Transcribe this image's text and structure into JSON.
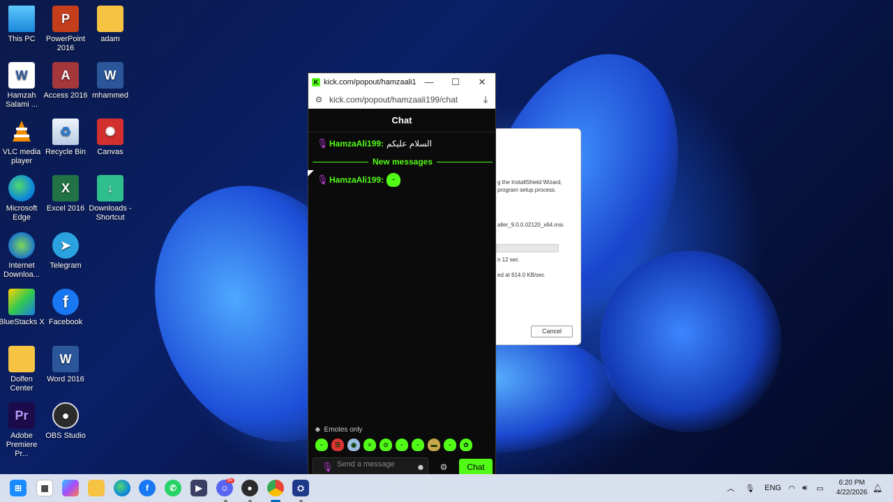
{
  "desktop": {
    "icons": [
      {
        "label": "This PC",
        "icon": "monitor-icon"
      },
      {
        "label": "PowerPoint 2016",
        "icon": "powerpoint-icon"
      },
      {
        "label": "adam",
        "icon": "folder-icon"
      },
      {
        "label": "Hamzah Salami ...",
        "icon": "word-doc-icon"
      },
      {
        "label": "Access 2016",
        "icon": "access-icon"
      },
      {
        "label": "mhammed",
        "icon": "word-doc-icon"
      },
      {
        "label": "VLC media player",
        "icon": "vlc-icon"
      },
      {
        "label": "Recycle Bin",
        "icon": "recycle-bin-icon"
      },
      {
        "label": "Canvas",
        "icon": "canvas-icon"
      },
      {
        "label": "Microsoft Edge",
        "icon": "edge-icon"
      },
      {
        "label": "Excel 2016",
        "icon": "excel-icon"
      },
      {
        "label": "Downloads - Shortcut",
        "icon": "downloads-folder-icon"
      },
      {
        "label": "Internet Downloa...",
        "icon": "idm-icon"
      },
      {
        "label": "Telegram",
        "icon": "telegram-icon"
      },
      {
        "label": "BlueStacks X",
        "icon": "bluestacks-icon"
      },
      {
        "label": "Facebook",
        "icon": "facebook-icon"
      },
      {
        "label": "Dolfen Center",
        "icon": "folder-user-icon"
      },
      {
        "label": "Word 2016",
        "icon": "word-icon"
      },
      {
        "label": "Adobe Premiere Pr...",
        "icon": "premiere-icon"
      },
      {
        "label": "OBS Studio",
        "icon": "obs-icon"
      }
    ]
  },
  "installer": {
    "line1": "g the InstallShield Wizard,",
    "line2": "program setup process.",
    "file": "aller_9.0.0.02120_x64.msi.",
    "time": "n 12 sec",
    "speed": "ed at 614.0 KB/sec",
    "cancel": "Cancel"
  },
  "popup": {
    "tab_title": "kick.com/popout/hamzaali1...",
    "url": "kick.com/popout/hamzaali199/chat",
    "header": "Chat",
    "messages": [
      {
        "user": "HamzaAli199:",
        "text": "السلام عليكم"
      },
      {
        "user": "HamzaAli199:",
        "text": ""
      }
    ],
    "new_messages_label": "New messages",
    "emotes_only_label": "Emotes only",
    "emote_count": 10,
    "input_placeholder": "Send a message",
    "chat_button": "Chat"
  },
  "taskbar": {
    "language": "ENG",
    "time": "6:20 PM",
    "date": "4/22/2026",
    "discord_badge": "9+"
  },
  "colors": {
    "kick_green": "#53fc18",
    "mic_purple": "#c13bd8",
    "chat_bg": "#0b0b0b"
  }
}
